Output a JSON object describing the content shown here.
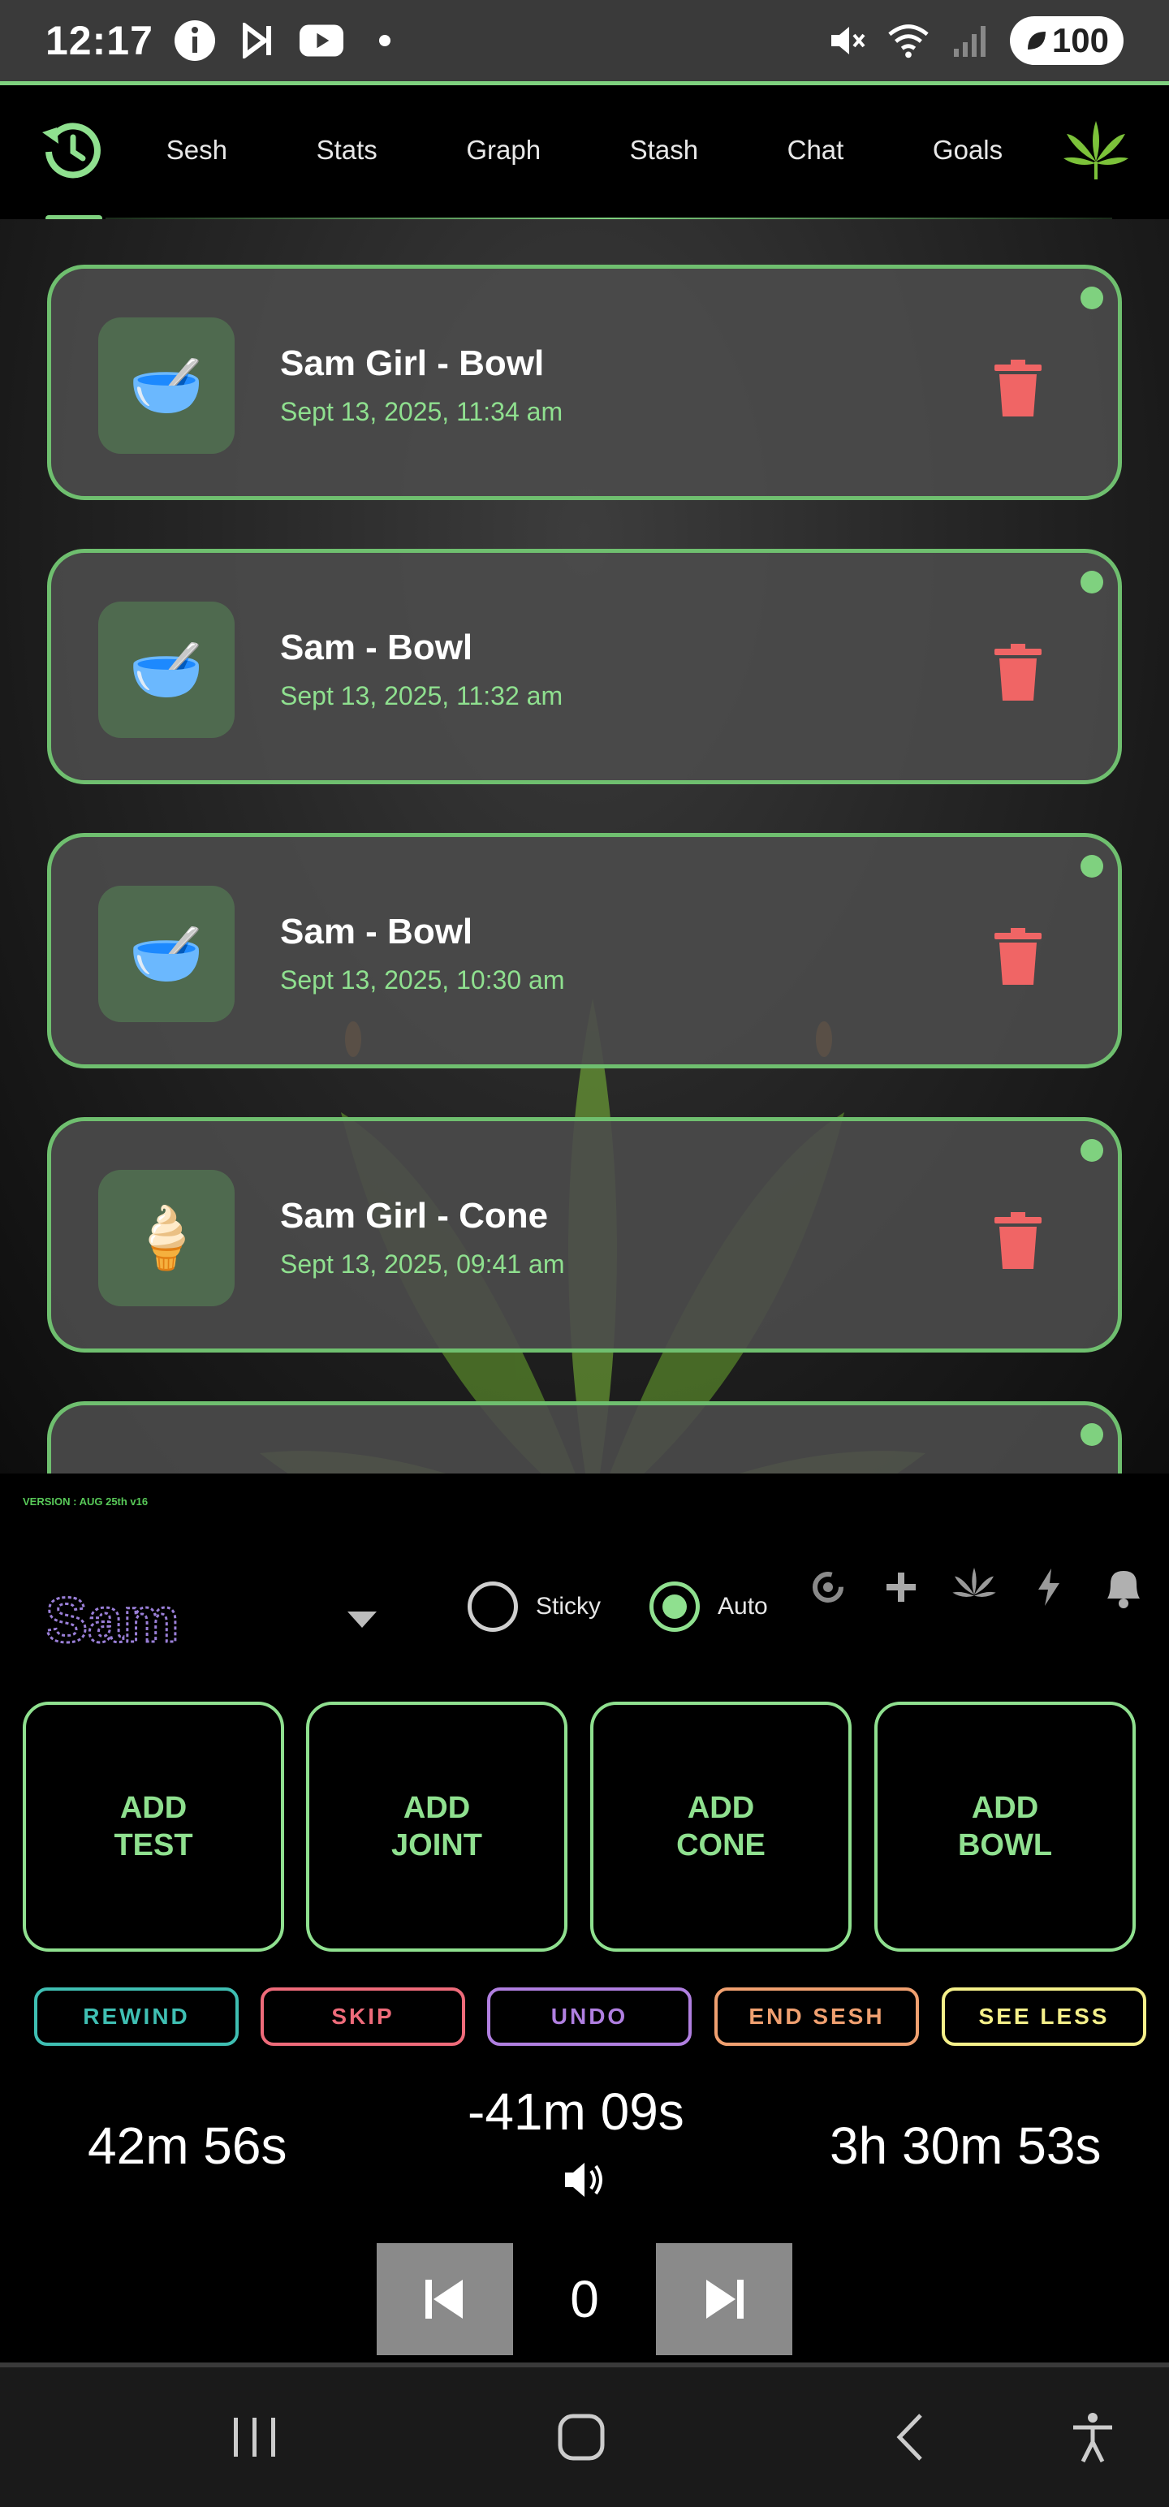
{
  "status_bar": {
    "time": "12:17",
    "battery": "100"
  },
  "nav": {
    "tabs": [
      "Sesh",
      "Stats",
      "Graph",
      "Stash",
      "Chat",
      "Goals"
    ]
  },
  "entries": [
    {
      "title": "Sam Girl - Bowl",
      "time": "Sept 13, 2025, 11:34 am",
      "emoji": "🥣"
    },
    {
      "title": "Sam - Bowl",
      "time": "Sept 13, 2025, 11:32 am",
      "emoji": "🥣"
    },
    {
      "title": "Sam - Bowl",
      "time": "Sept 13, 2025, 10:30 am",
      "emoji": "🥣"
    },
    {
      "title": "Sam Girl - Cone",
      "time": "Sept 13, 2025, 09:41 am",
      "emoji": "🍦"
    }
  ],
  "version": "VERSION : AUG 25th v16",
  "user": {
    "name": "Sam"
  },
  "mode": {
    "sticky_label": "Sticky",
    "auto_label": "Auto",
    "selected": "Auto"
  },
  "add_buttons": [
    {
      "line1": "ADD",
      "line2": "TEST"
    },
    {
      "line1": "ADD",
      "line2": "JOINT"
    },
    {
      "line1": "ADD",
      "line2": "CONE"
    },
    {
      "line1": "ADD",
      "line2": "BOWL"
    }
  ],
  "actions": [
    {
      "label": "REWIND",
      "color": "#3fbfb3"
    },
    {
      "label": "SKIP",
      "color": "#ee6b7a"
    },
    {
      "label": "UNDO",
      "color": "#b07fe0"
    },
    {
      "label": "END SESH",
      "color": "#f0a070"
    },
    {
      "label": "SEE LESS",
      "color": "#f5f08a"
    }
  ],
  "timers": {
    "left": "42m 56s",
    "center": "-41m 09s",
    "right": "3h 30m 53s"
  },
  "stepper": {
    "value": "0"
  },
  "colors": {
    "accent": "#8fe08f",
    "card_border": "#6fbf6f",
    "trash": "#f06565"
  }
}
